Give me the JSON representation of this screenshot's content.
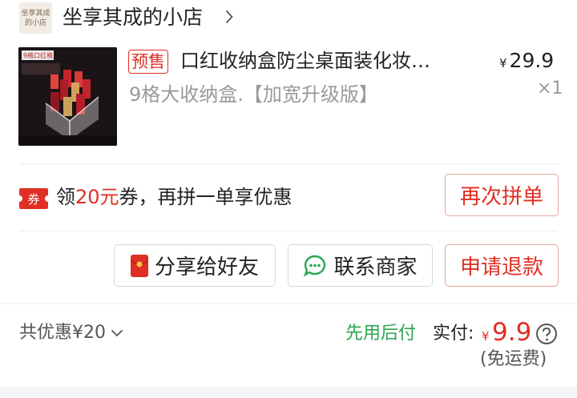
{
  "shop": {
    "logo_line1": "坐享其成",
    "logo_line2": "的小店",
    "name": "坐享其成的小店"
  },
  "product": {
    "image_label": "9格口红格",
    "presale_tag": "预售",
    "title": "口红收纳盒防尘桌面装化妆…",
    "price_symbol": "¥",
    "price": "29.9",
    "variant": "9格大收纳盒.【加宽升级版】",
    "quantity": "×1"
  },
  "coupon": {
    "icon_text": "券",
    "text_prefix": "领",
    "amount": "20元",
    "text_suffix": "券，再拼一单享优惠",
    "button": "再次拼单"
  },
  "actions": {
    "share": "分享给好友",
    "contact": "联系商家",
    "refund": "申请退款"
  },
  "summary": {
    "discount": "共优惠¥20",
    "pay_later": "先用后付",
    "paid_label": "实付:",
    "paid_symbol": "¥",
    "paid_amount": "9.9",
    "shipping": "(免运费)"
  },
  "colors": {
    "accent_red": "#e02e24",
    "pay_later_green": "#2aa64f"
  },
  "icons": {
    "shop_arrow": "chevron-right-icon",
    "coupon": "coupon-icon",
    "share": "red-envelope-icon",
    "contact": "chat-bubble-icon",
    "discount_toggle": "chevron-down-icon",
    "help": "question-circle-icon"
  }
}
